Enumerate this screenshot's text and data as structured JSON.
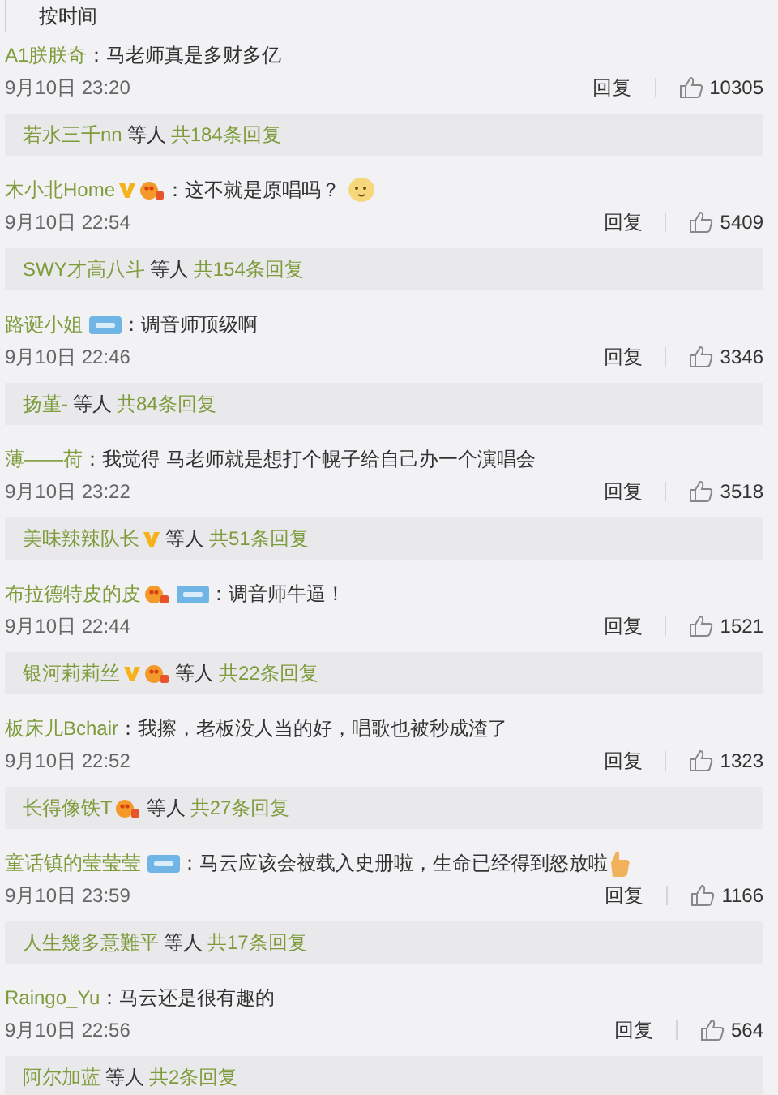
{
  "sort_tabs": [
    {
      "label": "按时间",
      "selected": true
    }
  ],
  "comments": [
    {
      "user": "A1朕朕奇",
      "text": "：马老师真是多财多亿",
      "date": "9月10日 23:20",
      "reply": "回复",
      "likes": "10305",
      "replies": {
        "user": "若水三千nn",
        "suffix": "等人",
        "count": "共184条回复"
      }
    },
    {
      "user": "木小北Home",
      "badges": [
        {
          "kind": "verified"
        },
        {
          "kind": "medal"
        }
      ],
      "text": "：这不就是原唱吗？",
      "emoji": {
        "kind": "face"
      },
      "date": "9月10日 22:54",
      "reply": "回复",
      "likes": "5409",
      "replies": {
        "user": "SWY才高八斗",
        "suffix": "等人",
        "count": "共154条回复"
      }
    },
    {
      "user": "路诞小姐",
      "badges": [
        {
          "kind": "fan"
        }
      ],
      "text": "：调音师顶级啊",
      "date": "9月10日 22:46",
      "reply": "回复",
      "likes": "3346",
      "replies": {
        "user": "扬堇-",
        "suffix": "等人",
        "count": "共84条回复"
      }
    },
    {
      "user": "薄——荷",
      "text": "：我觉得  马老师就是想打个幌子给自己办一个演唱会",
      "date": "9月10日 23:22",
      "reply": "回复",
      "likes": "3518",
      "replies": {
        "user": "美味辣辣队长",
        "badges": [
          {
            "kind": "verified"
          }
        ],
        "suffix": "等人",
        "count": "共51条回复"
      }
    },
    {
      "user": "布拉德特皮的皮",
      "badges": [
        {
          "kind": "medal"
        },
        {
          "kind": "fan"
        }
      ],
      "text": "：调音师牛逼！",
      "date": "9月10日 22:44",
      "reply": "回复",
      "likes": "1521",
      "replies": {
        "user": "银河莉莉丝",
        "badges": [
          {
            "kind": "verified"
          },
          {
            "kind": "medal"
          }
        ],
        "suffix": "等人",
        "count": "共22条回复"
      }
    },
    {
      "user": "板床儿Bchair",
      "text": "：我擦，老板没人当的好，唱歌也被秒成渣了",
      "date": "9月10日 22:52",
      "reply": "回复",
      "likes": "1323",
      "replies": {
        "user": "长得像铁T",
        "badges": [
          {
            "kind": "medal"
          }
        ],
        "suffix": "等人",
        "count": "共27条回复"
      }
    },
    {
      "user": "童话镇的莹莹莹",
      "badges": [
        {
          "kind": "fan"
        }
      ],
      "text": "：马云应该会被载入史册啦，生命已经得到怒放啦",
      "emoji": {
        "kind": "thumb"
      },
      "date": "9月10日 23:59",
      "reply": "回复",
      "likes": "1166",
      "replies": {
        "user": "人生幾多意難平",
        "suffix": "等人",
        "count": "共17条回复"
      }
    },
    {
      "user": "Raingo_Yu",
      "text": "：马云还是很有趣的",
      "date": "9月10日 22:56",
      "reply": "回复",
      "likes": "564",
      "replies": {
        "user": "阿尔加蓝",
        "suffix": "等人",
        "count": "共2条回复"
      }
    }
  ]
}
